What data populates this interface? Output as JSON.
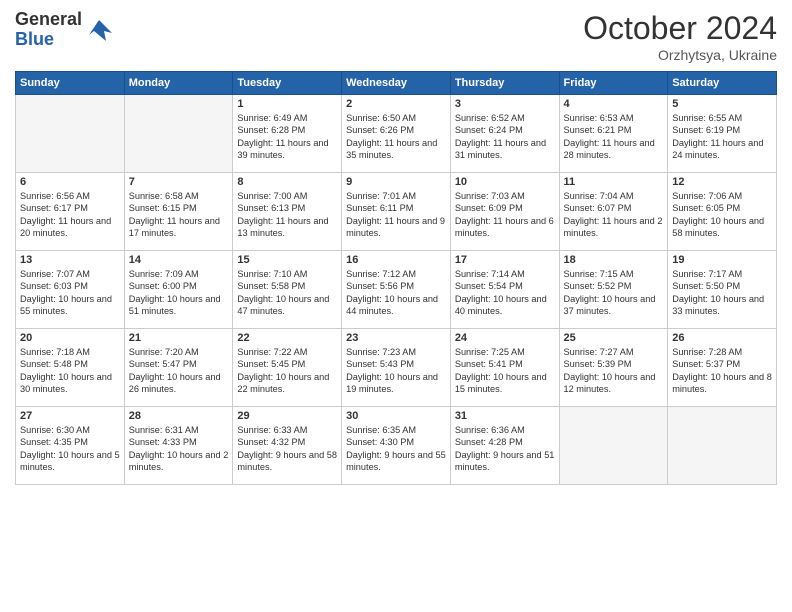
{
  "logo": {
    "general": "General",
    "blue": "Blue"
  },
  "header": {
    "month_year": "October 2024",
    "location": "Orzhytsya, Ukraine"
  },
  "days_of_week": [
    "Sunday",
    "Monday",
    "Tuesday",
    "Wednesday",
    "Thursday",
    "Friday",
    "Saturday"
  ],
  "weeks": [
    [
      {
        "day": "",
        "content": ""
      },
      {
        "day": "",
        "content": ""
      },
      {
        "day": "1",
        "content": "Sunrise: 6:49 AM\nSunset: 6:28 PM\nDaylight: 11 hours and 39 minutes."
      },
      {
        "day": "2",
        "content": "Sunrise: 6:50 AM\nSunset: 6:26 PM\nDaylight: 11 hours and 35 minutes."
      },
      {
        "day": "3",
        "content": "Sunrise: 6:52 AM\nSunset: 6:24 PM\nDaylight: 11 hours and 31 minutes."
      },
      {
        "day": "4",
        "content": "Sunrise: 6:53 AM\nSunset: 6:21 PM\nDaylight: 11 hours and 28 minutes."
      },
      {
        "day": "5",
        "content": "Sunrise: 6:55 AM\nSunset: 6:19 PM\nDaylight: 11 hours and 24 minutes."
      }
    ],
    [
      {
        "day": "6",
        "content": "Sunrise: 6:56 AM\nSunset: 6:17 PM\nDaylight: 11 hours and 20 minutes."
      },
      {
        "day": "7",
        "content": "Sunrise: 6:58 AM\nSunset: 6:15 PM\nDaylight: 11 hours and 17 minutes."
      },
      {
        "day": "8",
        "content": "Sunrise: 7:00 AM\nSunset: 6:13 PM\nDaylight: 11 hours and 13 minutes."
      },
      {
        "day": "9",
        "content": "Sunrise: 7:01 AM\nSunset: 6:11 PM\nDaylight: 11 hours and 9 minutes."
      },
      {
        "day": "10",
        "content": "Sunrise: 7:03 AM\nSunset: 6:09 PM\nDaylight: 11 hours and 6 minutes."
      },
      {
        "day": "11",
        "content": "Sunrise: 7:04 AM\nSunset: 6:07 PM\nDaylight: 11 hours and 2 minutes."
      },
      {
        "day": "12",
        "content": "Sunrise: 7:06 AM\nSunset: 6:05 PM\nDaylight: 10 hours and 58 minutes."
      }
    ],
    [
      {
        "day": "13",
        "content": "Sunrise: 7:07 AM\nSunset: 6:03 PM\nDaylight: 10 hours and 55 minutes."
      },
      {
        "day": "14",
        "content": "Sunrise: 7:09 AM\nSunset: 6:00 PM\nDaylight: 10 hours and 51 minutes."
      },
      {
        "day": "15",
        "content": "Sunrise: 7:10 AM\nSunset: 5:58 PM\nDaylight: 10 hours and 47 minutes."
      },
      {
        "day": "16",
        "content": "Sunrise: 7:12 AM\nSunset: 5:56 PM\nDaylight: 10 hours and 44 minutes."
      },
      {
        "day": "17",
        "content": "Sunrise: 7:14 AM\nSunset: 5:54 PM\nDaylight: 10 hours and 40 minutes."
      },
      {
        "day": "18",
        "content": "Sunrise: 7:15 AM\nSunset: 5:52 PM\nDaylight: 10 hours and 37 minutes."
      },
      {
        "day": "19",
        "content": "Sunrise: 7:17 AM\nSunset: 5:50 PM\nDaylight: 10 hours and 33 minutes."
      }
    ],
    [
      {
        "day": "20",
        "content": "Sunrise: 7:18 AM\nSunset: 5:48 PM\nDaylight: 10 hours and 30 minutes."
      },
      {
        "day": "21",
        "content": "Sunrise: 7:20 AM\nSunset: 5:47 PM\nDaylight: 10 hours and 26 minutes."
      },
      {
        "day": "22",
        "content": "Sunrise: 7:22 AM\nSunset: 5:45 PM\nDaylight: 10 hours and 22 minutes."
      },
      {
        "day": "23",
        "content": "Sunrise: 7:23 AM\nSunset: 5:43 PM\nDaylight: 10 hours and 19 minutes."
      },
      {
        "day": "24",
        "content": "Sunrise: 7:25 AM\nSunset: 5:41 PM\nDaylight: 10 hours and 15 minutes."
      },
      {
        "day": "25",
        "content": "Sunrise: 7:27 AM\nSunset: 5:39 PM\nDaylight: 10 hours and 12 minutes."
      },
      {
        "day": "26",
        "content": "Sunrise: 7:28 AM\nSunset: 5:37 PM\nDaylight: 10 hours and 8 minutes."
      }
    ],
    [
      {
        "day": "27",
        "content": "Sunrise: 6:30 AM\nSunset: 4:35 PM\nDaylight: 10 hours and 5 minutes."
      },
      {
        "day": "28",
        "content": "Sunrise: 6:31 AM\nSunset: 4:33 PM\nDaylight: 10 hours and 2 minutes."
      },
      {
        "day": "29",
        "content": "Sunrise: 6:33 AM\nSunset: 4:32 PM\nDaylight: 9 hours and 58 minutes."
      },
      {
        "day": "30",
        "content": "Sunrise: 6:35 AM\nSunset: 4:30 PM\nDaylight: 9 hours and 55 minutes."
      },
      {
        "day": "31",
        "content": "Sunrise: 6:36 AM\nSunset: 4:28 PM\nDaylight: 9 hours and 51 minutes."
      },
      {
        "day": "",
        "content": ""
      },
      {
        "day": "",
        "content": ""
      }
    ]
  ]
}
